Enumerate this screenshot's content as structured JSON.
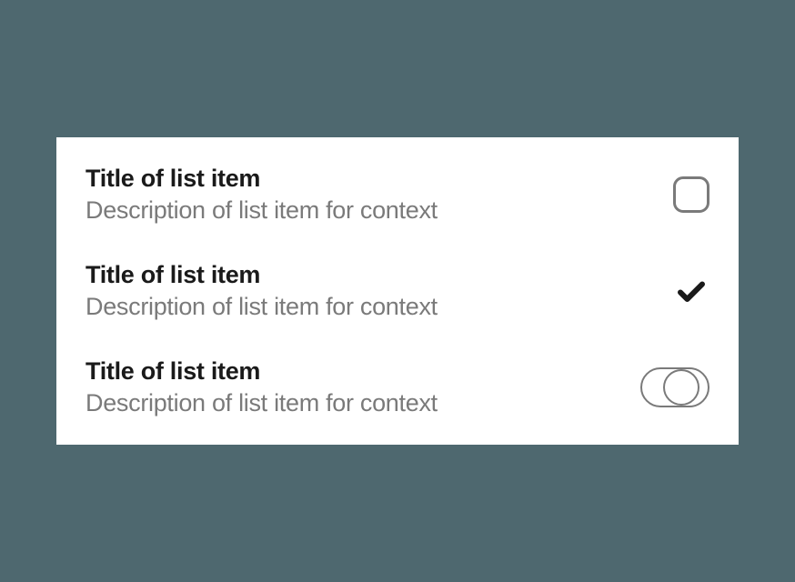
{
  "items": [
    {
      "title": "Title of list item",
      "description": "Description of list item for context",
      "control_type": "checkbox",
      "checked": false
    },
    {
      "title": "Title of list item",
      "description": "Description of list item for context",
      "control_type": "checkmark",
      "checked": true
    },
    {
      "title": "Title of list item",
      "description": "Description of list item for context",
      "control_type": "toggle",
      "checked": false
    }
  ]
}
